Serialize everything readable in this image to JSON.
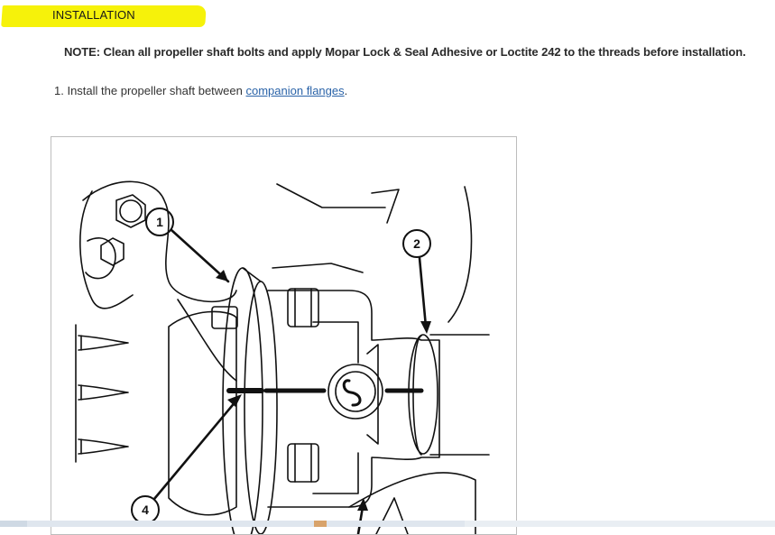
{
  "section": {
    "heading": "INSTALLATION"
  },
  "note": {
    "text": "NOTE: Clean all propeller shaft bolts and apply Mopar Lock & Seal Adhesive or Loctite 242 to the threads before installation."
  },
  "steps": [
    {
      "number": "1.",
      "text_before": "Install the propeller shaft between ",
      "link_text": "companion flanges",
      "text_after": "."
    }
  ],
  "figure": {
    "callouts": [
      "1",
      "2",
      "4"
    ]
  },
  "colors": {
    "highlight": "#f6f20a",
    "link": "#2a63a8"
  }
}
